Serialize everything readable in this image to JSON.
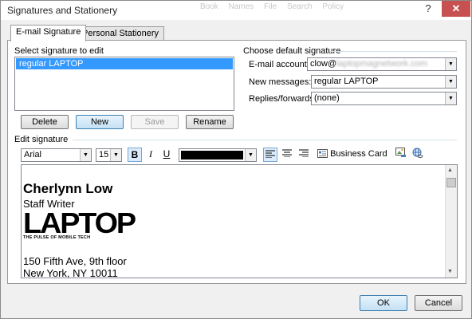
{
  "window": {
    "title": "Signatures and Stationery",
    "help_glyph": "?",
    "close_glyph": "✕",
    "ghost_menu": [
      "Book",
      "Names",
      "File",
      "Search",
      "Policy"
    ]
  },
  "tabs": [
    {
      "label": "E-mail Signature",
      "active": true
    },
    {
      "label": "Personal Stationery",
      "active": false
    }
  ],
  "select_signature": {
    "label": "Select signature to edit",
    "items": [
      "regular LAPTOP"
    ],
    "buttons": {
      "delete": "Delete",
      "new": "New",
      "save": "Save",
      "rename": "Rename"
    }
  },
  "default_signature": {
    "label": "Choose default signature",
    "email_account_label": "E-mail account:",
    "email_account_prefix": "clow@",
    "email_account_blurred": "laptopmagnetwork.com",
    "new_messages_label": "New messages:",
    "new_messages_value": "regular LAPTOP",
    "replies_label": "Replies/forwards:",
    "replies_value": "(none)"
  },
  "edit_signature": {
    "label": "Edit signature",
    "font": "Arial",
    "size": "15",
    "bold": "B",
    "italic": "I",
    "underline": "U",
    "color_hex": "#000000",
    "business_card": "Business Card"
  },
  "signature": {
    "name": "Cherlynn Low",
    "title": "Staff Writer",
    "logo_text": "LAPTOP",
    "logo_tagline": "THE PULSE OF MOBILE TECH",
    "address_lines": [
      "150 Fifth Ave, 9th floor",
      "New York, NY 10011"
    ]
  },
  "footer": {
    "ok": "OK",
    "cancel": "Cancel"
  }
}
